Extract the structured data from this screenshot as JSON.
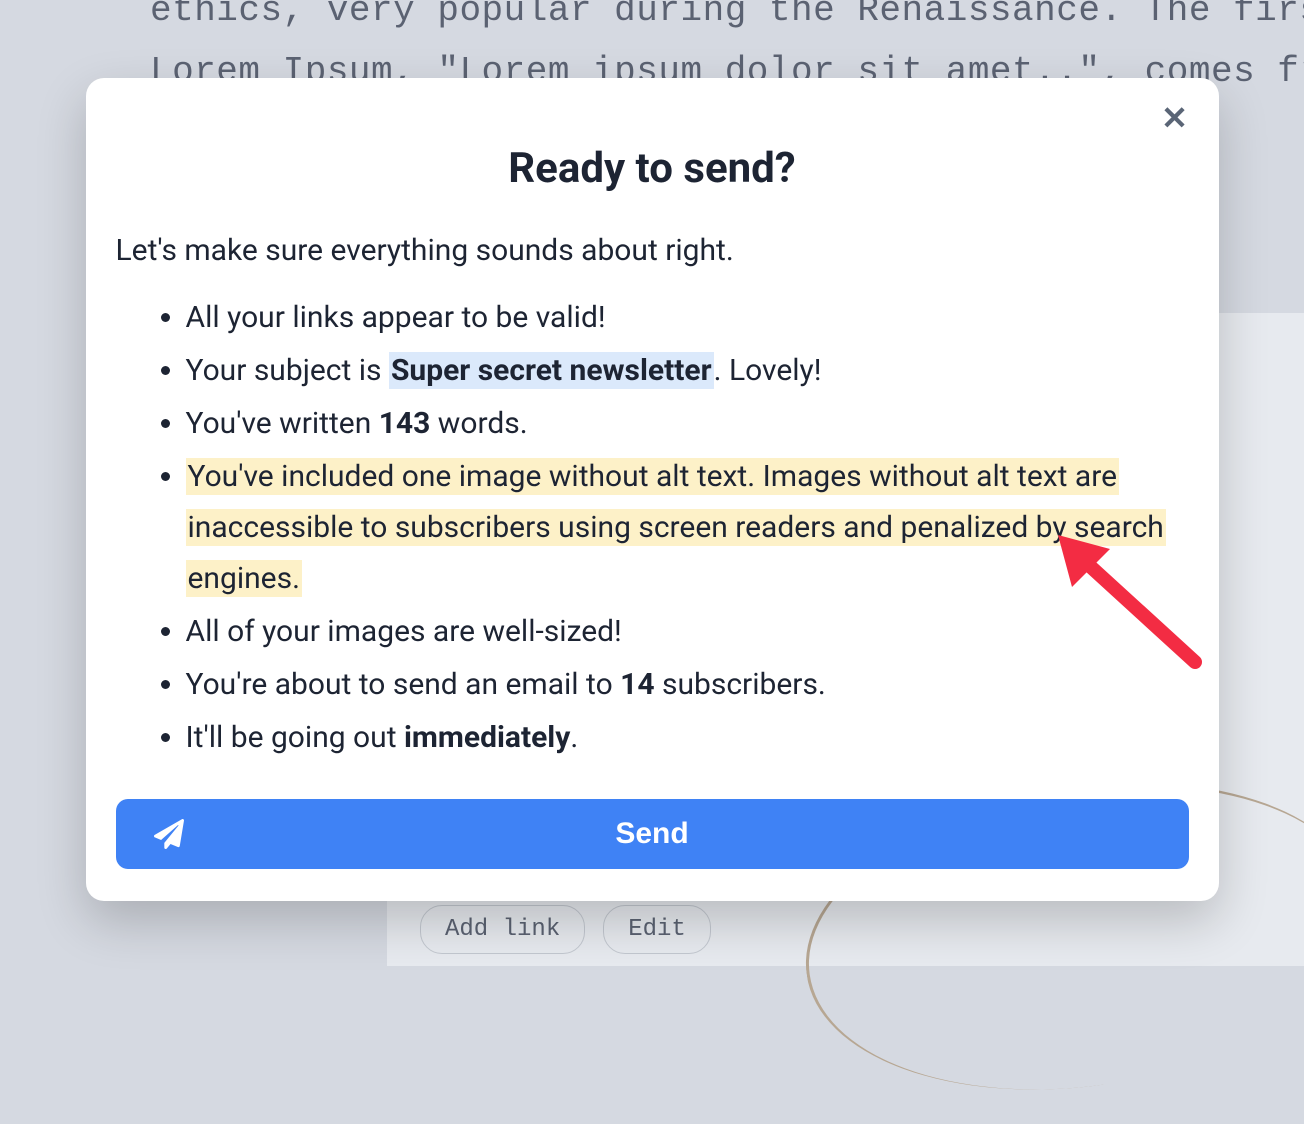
{
  "background": {
    "line1": "ethics, very popular during the Renaissance. The firs",
    "line2": "Lorem Ipsum, \"Lorem ipsum dolor sit amet..\", comes fro",
    "buttons": {
      "add_link": "Add link",
      "edit": "Edit"
    }
  },
  "modal": {
    "title": "Ready to send?",
    "intro": "Let's make sure everything sounds about right.",
    "checks": {
      "links_valid": "All your links appear to be valid!",
      "subject_prefix": "Your subject is ",
      "subject_value": "Super secret newsletter",
      "subject_suffix": ". Lovely!",
      "words_prefix": "You've written ",
      "words_count": "143",
      "words_suffix": " words.",
      "alt_text_warning": "You've included one image without alt text. Images without alt text are inaccessible to subscribers using screen readers and penalized by search engines.",
      "images_sized": "All of your images are well-sized!",
      "subscribers_prefix": "You're about to send an email to ",
      "subscribers_count": "14",
      "subscribers_suffix": " subscribers.",
      "schedule_prefix": "It'll be going out ",
      "schedule_value": "immediately",
      "schedule_suffix": "."
    },
    "send_label": "Send"
  }
}
